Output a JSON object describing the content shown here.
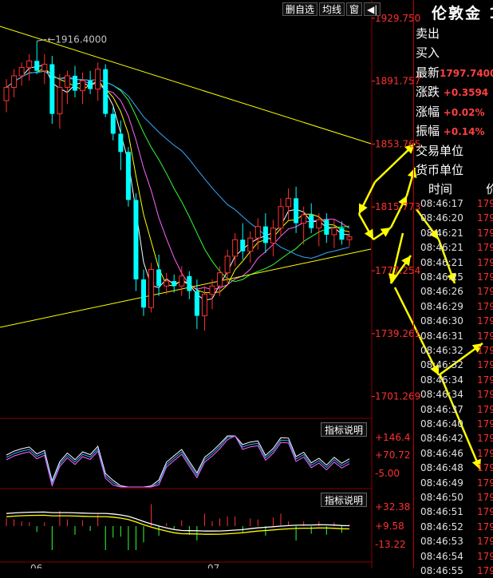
{
  "toolbar": {
    "items": [
      {
        "label": "删自选"
      },
      {
        "label": "均线"
      },
      {
        "label": "窗"
      },
      {
        "label": "◀|"
      }
    ]
  },
  "price_panel": {
    "high_marker": "1916.4000",
    "y_ticks": [
      "1929.750",
      "1891.757",
      "1853.765",
      "1815.773",
      "1777.254",
      "1739.261",
      "1701.269"
    ]
  },
  "indicator_panels": [
    {
      "button": "指标说明",
      "y_ticks": [
        "+146.4",
        "+70.72",
        "-5.00"
      ]
    },
    {
      "button": "指标说明",
      "y_ticks": [
        "+32.38",
        "+9.58",
        "-13.22"
      ]
    }
  ],
  "x_axis": {
    "labels": [
      "06",
      "07"
    ]
  },
  "quote": {
    "title": "伦敦金 1",
    "rows": [
      {
        "label": "卖出",
        "value": ""
      },
      {
        "label": "买入",
        "value": ""
      },
      {
        "label": "最新",
        "value": "1797.7400"
      },
      {
        "label": "涨跌",
        "value": "+0.3594"
      },
      {
        "label": "涨幅",
        "value": "+0.02%"
      },
      {
        "label": "振幅",
        "value": "+0.14%"
      }
    ],
    "extra": [
      "交易单位",
      "货币单位"
    ],
    "ticks_header": {
      "time": "时间",
      "price": "价"
    },
    "ticks": [
      {
        "time": "08:46:17",
        "price": "179"
      },
      {
        "time": "08:46:20",
        "price": "179"
      },
      {
        "time": "08:46:21",
        "price": "179"
      },
      {
        "time": "08:46:21",
        "price": "179"
      },
      {
        "time": "08:46:21",
        "price": "179"
      },
      {
        "time": "08:46:25",
        "price": "179"
      },
      {
        "time": "08:46:26",
        "price": "179"
      },
      {
        "time": "08:46:29",
        "price": "179"
      },
      {
        "time": "08:46:30",
        "price": "179"
      },
      {
        "time": "08:46:31",
        "price": "179"
      },
      {
        "time": "08:46:32",
        "price": "179"
      },
      {
        "time": "08:46:32",
        "price": "179"
      },
      {
        "time": "08:46:34",
        "price": "179"
      },
      {
        "time": "08:46:34",
        "price": "179"
      },
      {
        "time": "08:46:37",
        "price": "179"
      },
      {
        "time": "08:46:40",
        "price": "179"
      },
      {
        "time": "08:46:42",
        "price": "179"
      },
      {
        "time": "08:46:46",
        "price": "179"
      },
      {
        "time": "08:46:48",
        "price": "179"
      },
      {
        "time": "08:46:49",
        "price": "179"
      },
      {
        "time": "08:46:50",
        "price": "179"
      },
      {
        "time": "08:46:51",
        "price": "179"
      },
      {
        "time": "08:46:52",
        "price": "179"
      },
      {
        "time": "08:46:53",
        "price": "179"
      },
      {
        "time": "08:46:54",
        "price": "179"
      },
      {
        "time": "08:46:55",
        "price": "179"
      }
    ]
  },
  "colors": {
    "up": "#ff3030",
    "down": "#00ffff",
    "ma1": "#ffffff",
    "ma2": "#ffff00",
    "ma3": "#ff66ff",
    "ma4": "#33ff33",
    "ma5": "#33aaff",
    "trendline": "#ffff00",
    "arrow": "#ffff00",
    "grid": "#880000"
  },
  "chart_data": {
    "type": "candlestick",
    "ylim": [
      1690,
      1935
    ],
    "candles": [
      {
        "o": 1880,
        "h": 1893,
        "l": 1873,
        "c": 1888
      },
      {
        "o": 1888,
        "h": 1899,
        "l": 1882,
        "c": 1895
      },
      {
        "o": 1895,
        "h": 1903,
        "l": 1889,
        "c": 1900
      },
      {
        "o": 1900,
        "h": 1908,
        "l": 1892,
        "c": 1904
      },
      {
        "o": 1904,
        "h": 1916,
        "l": 1896,
        "c": 1898
      },
      {
        "o": 1898,
        "h": 1908,
        "l": 1890,
        "c": 1902
      },
      {
        "o": 1902,
        "h": 1907,
        "l": 1866,
        "c": 1872
      },
      {
        "o": 1872,
        "h": 1896,
        "l": 1863,
        "c": 1888
      },
      {
        "o": 1888,
        "h": 1898,
        "l": 1878,
        "c": 1895
      },
      {
        "o": 1895,
        "h": 1901,
        "l": 1882,
        "c": 1886
      },
      {
        "o": 1886,
        "h": 1897,
        "l": 1878,
        "c": 1892
      },
      {
        "o": 1892,
        "h": 1898,
        "l": 1884,
        "c": 1887
      },
      {
        "o": 1887,
        "h": 1903,
        "l": 1880,
        "c": 1899
      },
      {
        "o": 1899,
        "h": 1902,
        "l": 1870,
        "c": 1872
      },
      {
        "o": 1872,
        "h": 1876,
        "l": 1856,
        "c": 1860
      },
      {
        "o": 1860,
        "h": 1868,
        "l": 1838,
        "c": 1849
      },
      {
        "o": 1849,
        "h": 1852,
        "l": 1816,
        "c": 1820
      },
      {
        "o": 1820,
        "h": 1824,
        "l": 1765,
        "c": 1772
      },
      {
        "o": 1772,
        "h": 1778,
        "l": 1750,
        "c": 1755
      },
      {
        "o": 1755,
        "h": 1782,
        "l": 1752,
        "c": 1778
      },
      {
        "o": 1778,
        "h": 1787,
        "l": 1762,
        "c": 1768
      },
      {
        "o": 1768,
        "h": 1776,
        "l": 1763,
        "c": 1771
      },
      {
        "o": 1771,
        "h": 1775,
        "l": 1764,
        "c": 1768
      },
      {
        "o": 1768,
        "h": 1780,
        "l": 1762,
        "c": 1774
      },
      {
        "o": 1774,
        "h": 1777,
        "l": 1760,
        "c": 1765
      },
      {
        "o": 1765,
        "h": 1772,
        "l": 1742,
        "c": 1750
      },
      {
        "o": 1750,
        "h": 1768,
        "l": 1741,
        "c": 1763
      },
      {
        "o": 1763,
        "h": 1772,
        "l": 1754,
        "c": 1768
      },
      {
        "o": 1768,
        "h": 1780,
        "l": 1762,
        "c": 1776
      },
      {
        "o": 1776,
        "h": 1790,
        "l": 1770,
        "c": 1786
      },
      {
        "o": 1786,
        "h": 1800,
        "l": 1780,
        "c": 1796
      },
      {
        "o": 1796,
        "h": 1806,
        "l": 1784,
        "c": 1789
      },
      {
        "o": 1789,
        "h": 1801,
        "l": 1782,
        "c": 1797
      },
      {
        "o": 1797,
        "h": 1809,
        "l": 1790,
        "c": 1804
      },
      {
        "o": 1804,
        "h": 1812,
        "l": 1788,
        "c": 1794
      },
      {
        "o": 1794,
        "h": 1808,
        "l": 1786,
        "c": 1803
      },
      {
        "o": 1803,
        "h": 1821,
        "l": 1798,
        "c": 1816
      },
      {
        "o": 1816,
        "h": 1827,
        "l": 1808,
        "c": 1821
      },
      {
        "o": 1821,
        "h": 1828,
        "l": 1800,
        "c": 1806
      },
      {
        "o": 1806,
        "h": 1816,
        "l": 1793,
        "c": 1811
      },
      {
        "o": 1811,
        "h": 1818,
        "l": 1800,
        "c": 1803
      },
      {
        "o": 1803,
        "h": 1812,
        "l": 1792,
        "c": 1808
      },
      {
        "o": 1808,
        "h": 1812,
        "l": 1794,
        "c": 1799
      },
      {
        "o": 1799,
        "h": 1808,
        "l": 1791,
        "c": 1803
      },
      {
        "o": 1803,
        "h": 1807,
        "l": 1793,
        "c": 1796
      },
      {
        "o": 1796,
        "h": 1800,
        "l": 1792,
        "c": 1797.74
      }
    ]
  }
}
